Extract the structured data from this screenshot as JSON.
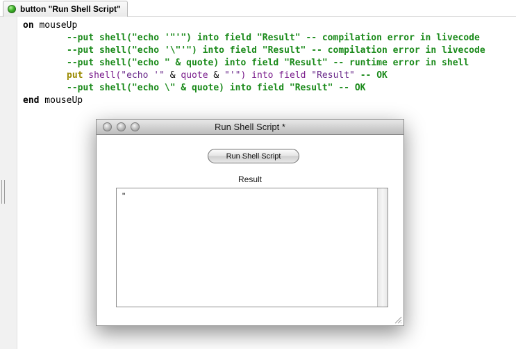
{
  "tab": {
    "label": "button \"Run Shell Script\""
  },
  "code": {
    "line1_kw": "on",
    "line1_name": " mouseUp",
    "line2": "--put shell(\"echo '\"'\") into field \"Result\" -- compilation error in livecode",
    "line3": "--put shell(\"echo '\\\"'\") into field \"Result\" -- compilation error in livecode",
    "line4": "--put shell(\"echo \" & quote) into field \"Result\" -- runtime error in shell",
    "line5": {
      "put": "put",
      "shell": " shell(",
      "str1": "\"echo '\"",
      "amp1": " & ",
      "quote": "quote",
      "amp2": " & ",
      "str2": "\"'\"",
      "into": ") into ",
      "field": "field",
      "sp": " ",
      "result": "\"Result\"",
      "comment": " -- OK"
    },
    "line6": "--put shell(\"echo \\\" & quote) into field \"Result\" -- OK",
    "line7_kw": "end",
    "line7_name": " mouseUp"
  },
  "window": {
    "title": "Run Shell Script *",
    "button_label": "Run Shell Script",
    "result_label": "Result",
    "result_value": "\""
  },
  "colors": {
    "comment": "#1a8a1a",
    "put_keyword": "#9a8a00",
    "function": "#7a1d8c",
    "tab_dot": "#3fb52a"
  }
}
